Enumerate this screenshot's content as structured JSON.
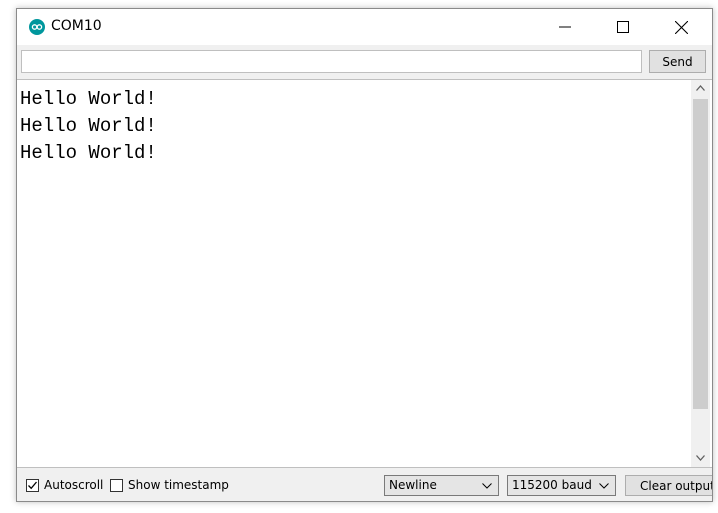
{
  "window": {
    "title": "COM10",
    "icon": "arduino-icon",
    "accent_color": "#00979d"
  },
  "title_buttons": {
    "minimize_icon": "minimize-icon",
    "maximize_icon": "maximize-icon",
    "close_icon": "close-icon"
  },
  "input": {
    "value": "",
    "placeholder": "",
    "send_label": "Send"
  },
  "output": {
    "lines": [
      "Hello World!",
      "Hello World!",
      "Hello World!"
    ]
  },
  "status_bar": {
    "autoscroll": {
      "label": "Autoscroll",
      "checked": true
    },
    "show_timestamp": {
      "label": "Show timestamp",
      "checked": false
    },
    "line_ending": {
      "selected": "Newline"
    },
    "baud_rate": {
      "selected": "115200 baud"
    },
    "clear_label": "Clear output"
  }
}
